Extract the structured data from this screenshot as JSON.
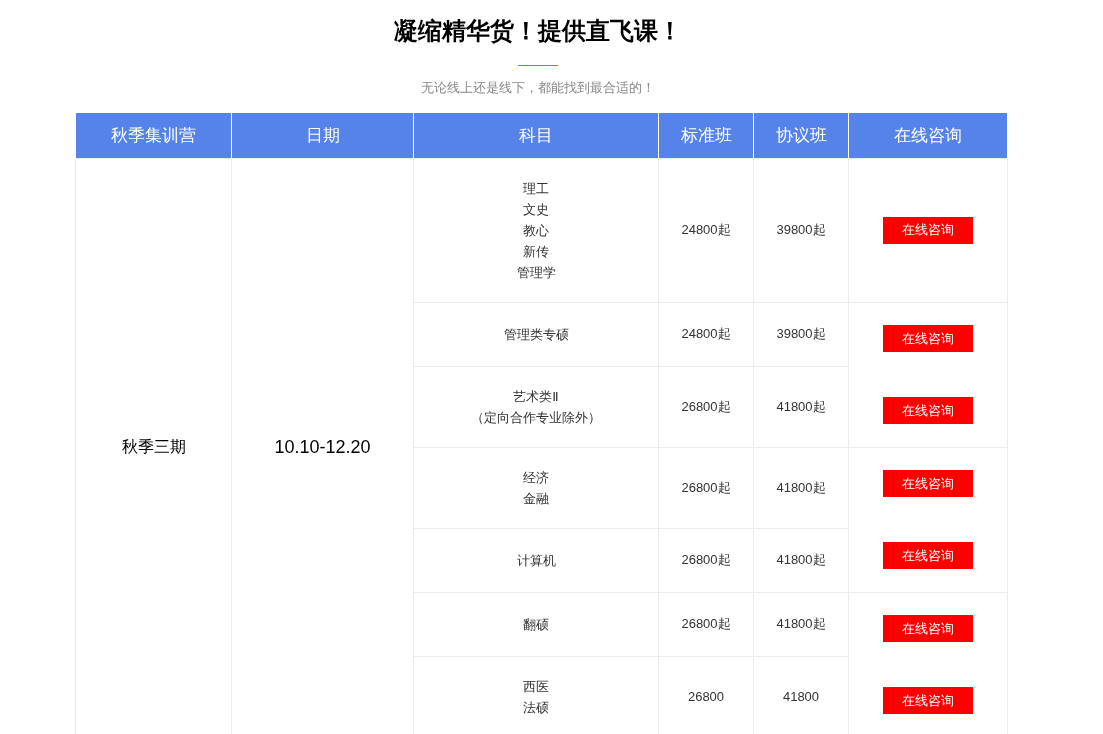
{
  "title": "凝缩精华货！提供直飞课！",
  "subtitle": "无论线上还是线下，都能找到最合适的！",
  "table": {
    "columns": [
      "秋季集训营",
      "日期",
      "科目",
      "标准班",
      "协议班",
      "在线咨询"
    ],
    "camp": "秋季三期",
    "date": "10.10-12.20",
    "groups": [
      {
        "consult_buttons": [
          "在线咨询"
        ],
        "rows": [
          {
            "subjects": [
              "理工",
              "文史",
              "教心",
              "新传",
              "管理学"
            ],
            "standard": "24800起",
            "agreement": "39800起"
          }
        ]
      },
      {
        "consult_buttons": [
          "在线咨询",
          "在线咨询"
        ],
        "rows": [
          {
            "subjects": [
              "管理类专硕"
            ],
            "standard": "24800起",
            "agreement": "39800起"
          },
          {
            "subjects": [
              "艺术类Ⅱ",
              "（定向合作专业除外）"
            ],
            "standard": "26800起",
            "agreement": "41800起"
          }
        ]
      },
      {
        "consult_buttons": [
          "在线咨询",
          "在线咨询"
        ],
        "rows": [
          {
            "subjects": [
              "经济",
              "金融"
            ],
            "standard": "26800起",
            "agreement": "41800起"
          },
          {
            "subjects": [
              "计算机"
            ],
            "standard": "26800起",
            "agreement": "41800起"
          }
        ]
      },
      {
        "consult_buttons": [
          "在线咨询",
          "在线咨询"
        ],
        "rows": [
          {
            "subjects": [
              "翻硕"
            ],
            "standard": "26800起",
            "agreement": "41800起"
          },
          {
            "subjects": [
              "西医",
              "法硕"
            ],
            "standard": "26800",
            "agreement": "41800"
          }
        ]
      }
    ]
  }
}
